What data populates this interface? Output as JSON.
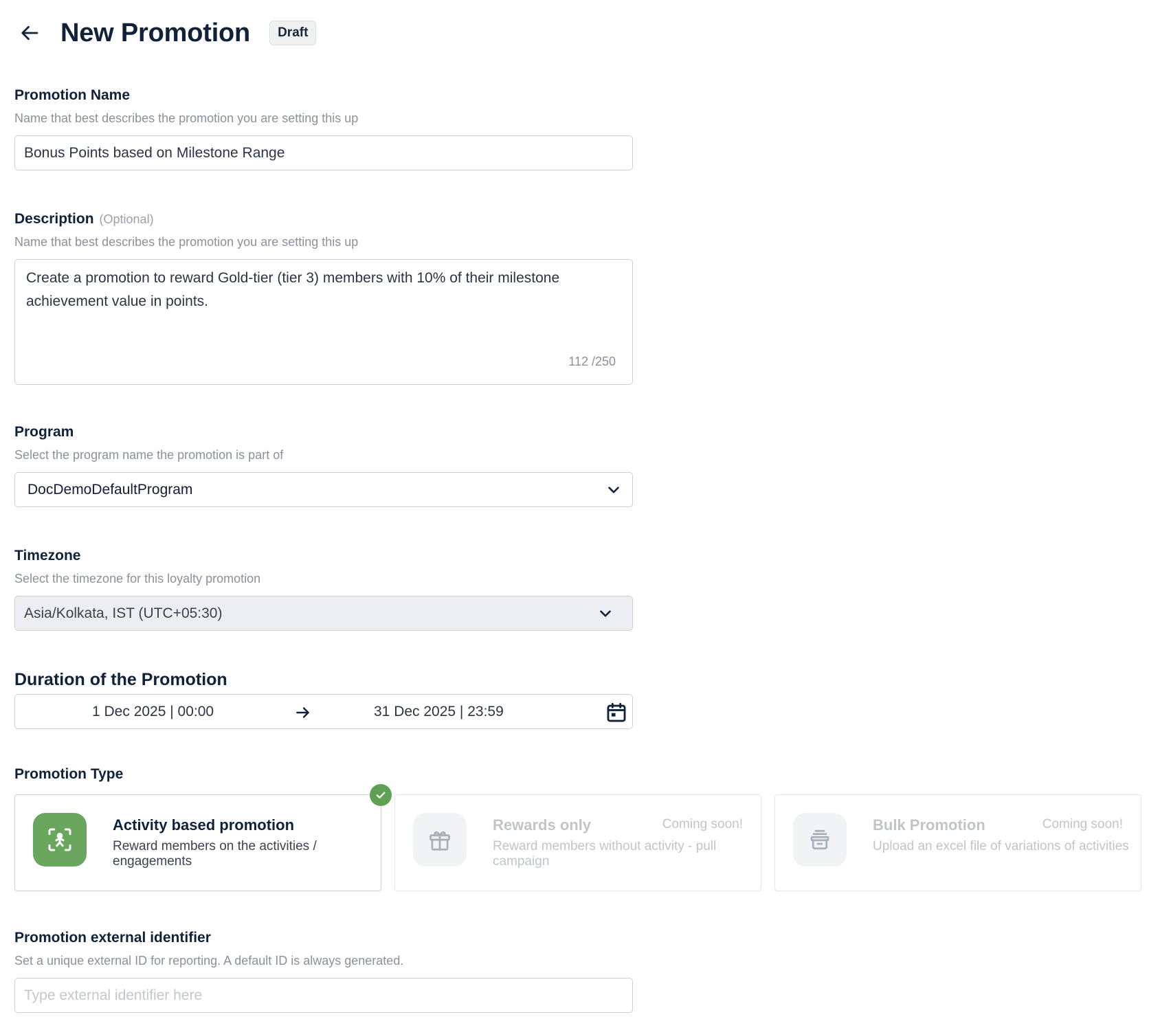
{
  "header": {
    "title": "New Promotion",
    "status_badge": "Draft"
  },
  "promotion_name": {
    "label": "Promotion Name",
    "help": "Name that best describes the promotion you are setting this up",
    "value": "Bonus Points based on Milestone Range"
  },
  "description": {
    "label": "Description",
    "optional": "(Optional)",
    "help": "Name that best describes the promotion you are setting this up",
    "value": "Create a promotion to reward Gold-tier (tier 3) members with 10% of their milestone achievement value in points.",
    "counter": "112 /250"
  },
  "program": {
    "label": "Program",
    "help": "Select the program name the promotion is part of",
    "selected": "DocDemoDefaultProgram"
  },
  "timezone": {
    "label": "Timezone",
    "help": "Select the timezone for this loyalty promotion",
    "selected": "Asia/Kolkata, IST (UTC+05:30)"
  },
  "duration": {
    "label": "Duration of the Promotion",
    "start": "1 Dec 2025 | 00:00",
    "end": "31 Dec 2025 | 23:59"
  },
  "promotion_type": {
    "label": "Promotion Type",
    "options": [
      {
        "title": "Activity based promotion",
        "desc": "Reward members on the activities / engagements",
        "badge": "",
        "icon": "activity-scan-icon"
      },
      {
        "title": "Rewards only",
        "desc": "Reward members without activity - pull campaign",
        "badge": "Coming soon!",
        "icon": "gift-icon"
      },
      {
        "title": "Bulk Promotion",
        "desc": "Upload an excel file of variations of activities",
        "badge": "Coming soon!",
        "icon": "archive-box-icon"
      }
    ]
  },
  "external_id": {
    "label": "Promotion external identifier",
    "help": "Set a unique external ID for reporting. A default ID is always generated.",
    "placeholder": "Type external identifier here"
  },
  "colors": {
    "accent_green": "#6ba65e",
    "text_primary": "#10213a",
    "text_muted": "#8a919b",
    "border": "#cdd1d6"
  }
}
